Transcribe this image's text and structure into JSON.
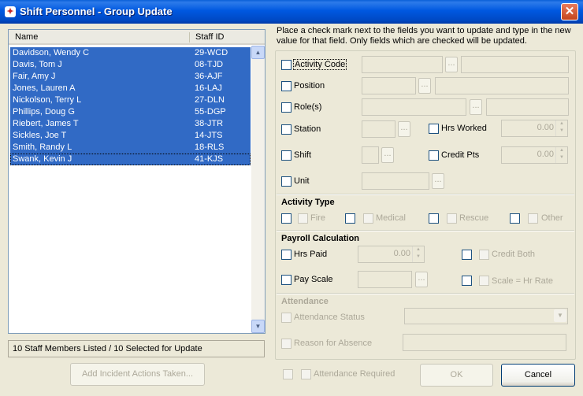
{
  "window": {
    "title": "Shift Personnel - Group Update"
  },
  "list": {
    "columns": {
      "name": "Name",
      "staff_id": "Staff ID"
    },
    "rows": [
      {
        "name": "Davidson, Wendy C",
        "id": "29-WCD"
      },
      {
        "name": "Davis, Tom J",
        "id": "08-TJD"
      },
      {
        "name": "Fair, Amy J",
        "id": "36-AJF"
      },
      {
        "name": "Jones, Lauren A",
        "id": "16-LAJ"
      },
      {
        "name": "Nickolson, Terry L",
        "id": "27-DLN"
      },
      {
        "name": "Phillips, Doug G",
        "id": "55-DGP"
      },
      {
        "name": "Riebert, James T",
        "id": "38-JTR"
      },
      {
        "name": "Sickles, Joe T",
        "id": "14-JTS"
      },
      {
        "name": "Smith, Randy L",
        "id": "18-RLS"
      },
      {
        "name": "Swank, Kevin J",
        "id": "41-KJS"
      }
    ]
  },
  "status": "10 Staff Members Listed / 10 Selected for Update",
  "buttons": {
    "add_incident": "Add Incident Actions Taken...",
    "ok": "OK",
    "cancel": "Cancel",
    "browse": "..."
  },
  "instructions": "Place a check mark next to the fields you want to update and type in the new value for that field. Only fields which are checked will be updated.",
  "fields": {
    "activity_code": "Activity Code",
    "position": "Position",
    "roles": "Role(s)",
    "station": "Station",
    "hrs_worked": "Hrs Worked",
    "hrs_worked_value": "0.00",
    "shift": "Shift",
    "credit_pts": "Credit Pts",
    "credit_pts_value": "0.00",
    "unit": "Unit"
  },
  "activity_type": {
    "title": "Activity Type",
    "options": [
      "Fire",
      "Medical",
      "Rescue",
      "Other"
    ]
  },
  "payroll": {
    "title": "Payroll Calculation",
    "hrs_paid": "Hrs Paid",
    "hrs_paid_value": "0.00",
    "credit_both": "Credit Both",
    "pay_scale": "Pay Scale",
    "scale_hr_rate": "Scale = Hr Rate"
  },
  "attendance": {
    "title": "Attendance",
    "status": "Attendance Status",
    "reason": "Reason for Absence",
    "required": "Attendance Required"
  }
}
